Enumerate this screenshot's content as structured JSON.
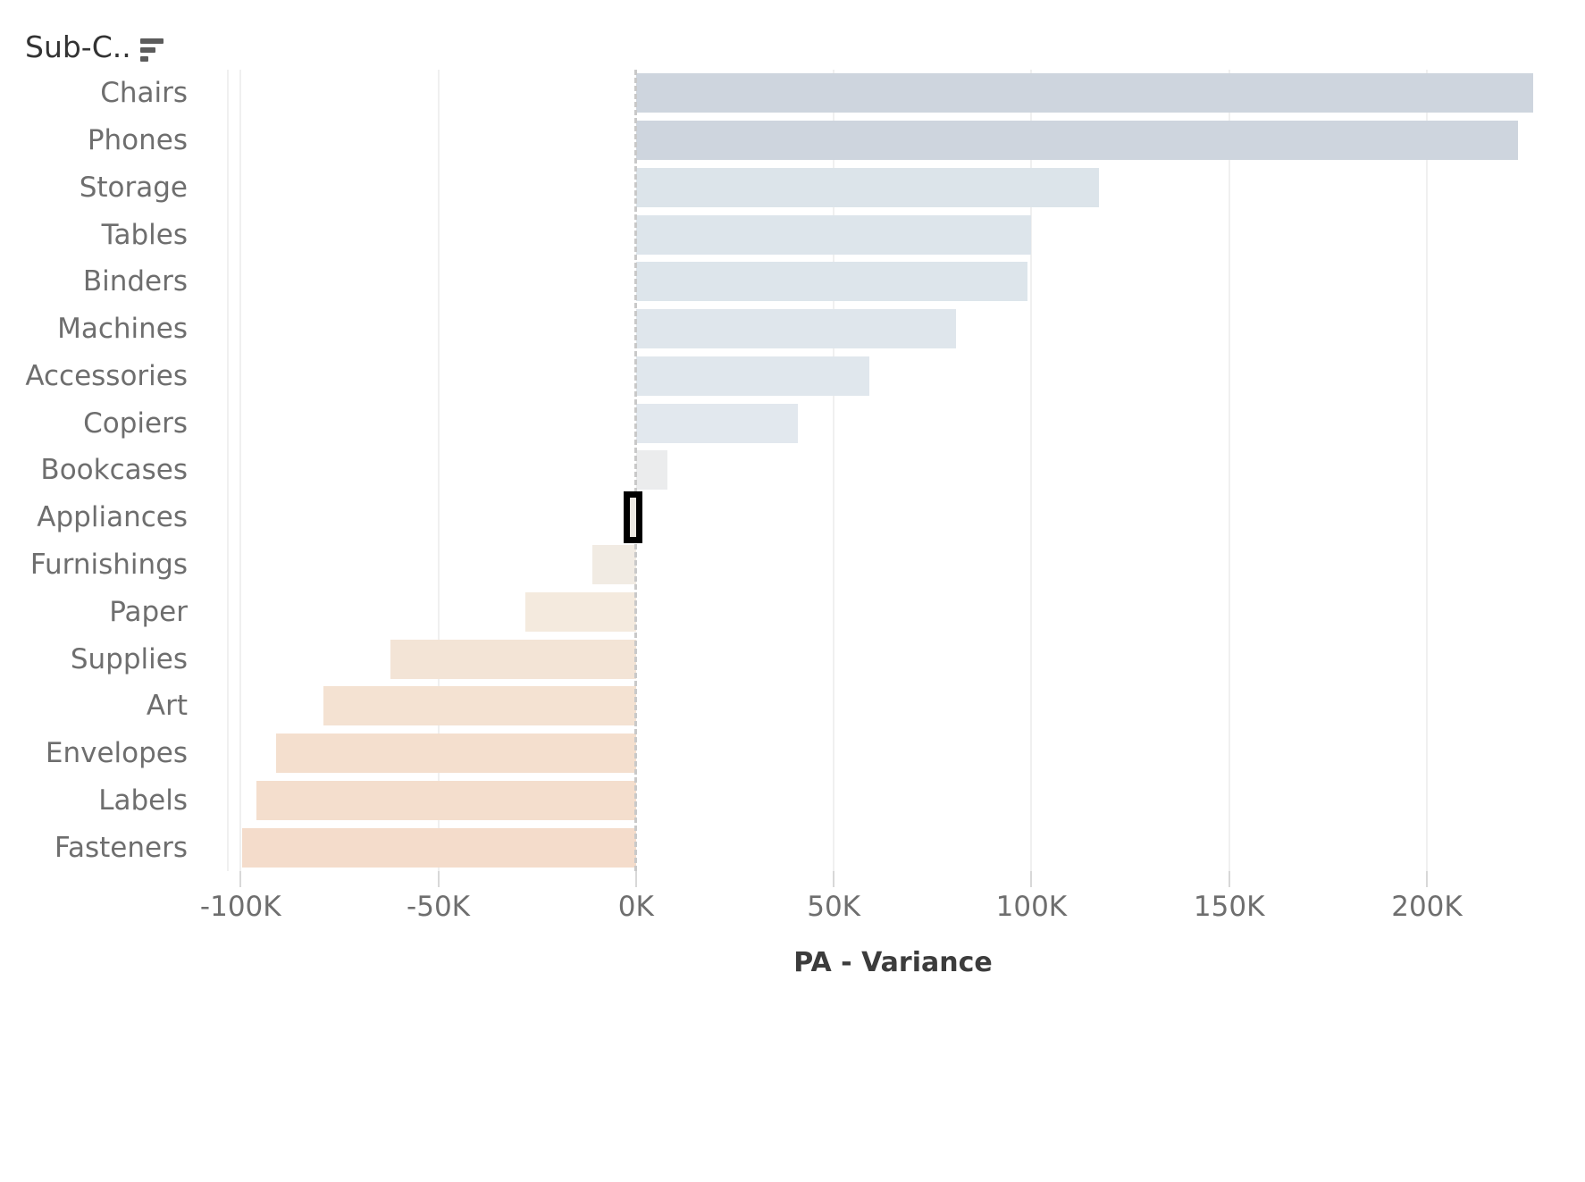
{
  "header": {
    "field_label": "Sub-C..",
    "sort_icon": "sort-descending-icon"
  },
  "axis": {
    "x_title": "PA - Variance",
    "x_ticks": [
      "-100K",
      "-50K",
      "0K",
      "50K",
      "100K",
      "150K",
      "200K"
    ],
    "x_tick_values": [
      -100000,
      -50000,
      0,
      50000,
      100000,
      150000,
      200000
    ]
  },
  "colors": {
    "positive_dark": "#ced5de",
    "positive_mid": "#d7dfe6",
    "positive_light": "#dce4ea",
    "neutral": "#ebeced",
    "negative_light": "#f4efe9",
    "negative_mid": "#f2e6da",
    "negative_dark": "#f4dccb",
    "selection_outline": "#000000",
    "gridline": "#f0f0f0",
    "zero_line": "#c9c9c9",
    "label_text": "#6e6e6e"
  },
  "chart_data": {
    "type": "bar",
    "orientation": "horizontal",
    "title": "",
    "xlabel": "PA - Variance",
    "ylabel": "Sub-Category",
    "xlim": [
      -110000,
      240000
    ],
    "grid": true,
    "legend": false,
    "sorted": "descending by value",
    "categories": [
      "Chairs",
      "Phones",
      "Storage",
      "Tables",
      "Binders",
      "Machines",
      "Accessories",
      "Copiers",
      "Bookcases",
      "Appliances",
      "Furnishings",
      "Paper",
      "Supplies",
      "Art",
      "Envelopes",
      "Labels",
      "Fasteners"
    ],
    "values": [
      227000,
      223000,
      117000,
      100000,
      99000,
      81000,
      59000,
      41000,
      8000,
      -1500,
      -11000,
      -28000,
      -62000,
      -79000,
      -91000,
      -96000,
      -99500
    ],
    "selected_category": "Appliances",
    "bars": [
      {
        "label": "Chairs",
        "value": 227000,
        "color": "#ced5de",
        "selected": false
      },
      {
        "label": "Phones",
        "value": 223000,
        "color": "#ced5de",
        "selected": false
      },
      {
        "label": "Storage",
        "value": 117000,
        "color": "#dce4ea",
        "selected": false
      },
      {
        "label": "Tables",
        "value": 100000,
        "color": "#dde5eb",
        "selected": false
      },
      {
        "label": "Binders",
        "value": 99000,
        "color": "#dde5eb",
        "selected": false
      },
      {
        "label": "Machines",
        "value": 81000,
        "color": "#dfe6ec",
        "selected": false
      },
      {
        "label": "Accessories",
        "value": 59000,
        "color": "#e0e7ed",
        "selected": false
      },
      {
        "label": "Copiers",
        "value": 41000,
        "color": "#e2e8ee",
        "selected": false
      },
      {
        "label": "Bookcases",
        "value": 8000,
        "color": "#ebeced",
        "selected": false
      },
      {
        "label": "Appliances",
        "value": -1500,
        "color": "#ece8e2",
        "selected": true
      },
      {
        "label": "Furnishings",
        "value": -11000,
        "color": "#f1ebe3",
        "selected": false
      },
      {
        "label": "Paper",
        "value": -28000,
        "color": "#f4eade",
        "selected": false
      },
      {
        "label": "Supplies",
        "value": -62000,
        "color": "#f3e4d6",
        "selected": false
      },
      {
        "label": "Art",
        "value": -79000,
        "color": "#f4e2d2",
        "selected": false
      },
      {
        "label": "Envelopes",
        "value": -91000,
        "color": "#f4dfce",
        "selected": false
      },
      {
        "label": "Labels",
        "value": -96000,
        "color": "#f4decd",
        "selected": false
      },
      {
        "label": "Fasteners",
        "value": -99500,
        "color": "#f4dccb",
        "selected": false
      }
    ]
  }
}
